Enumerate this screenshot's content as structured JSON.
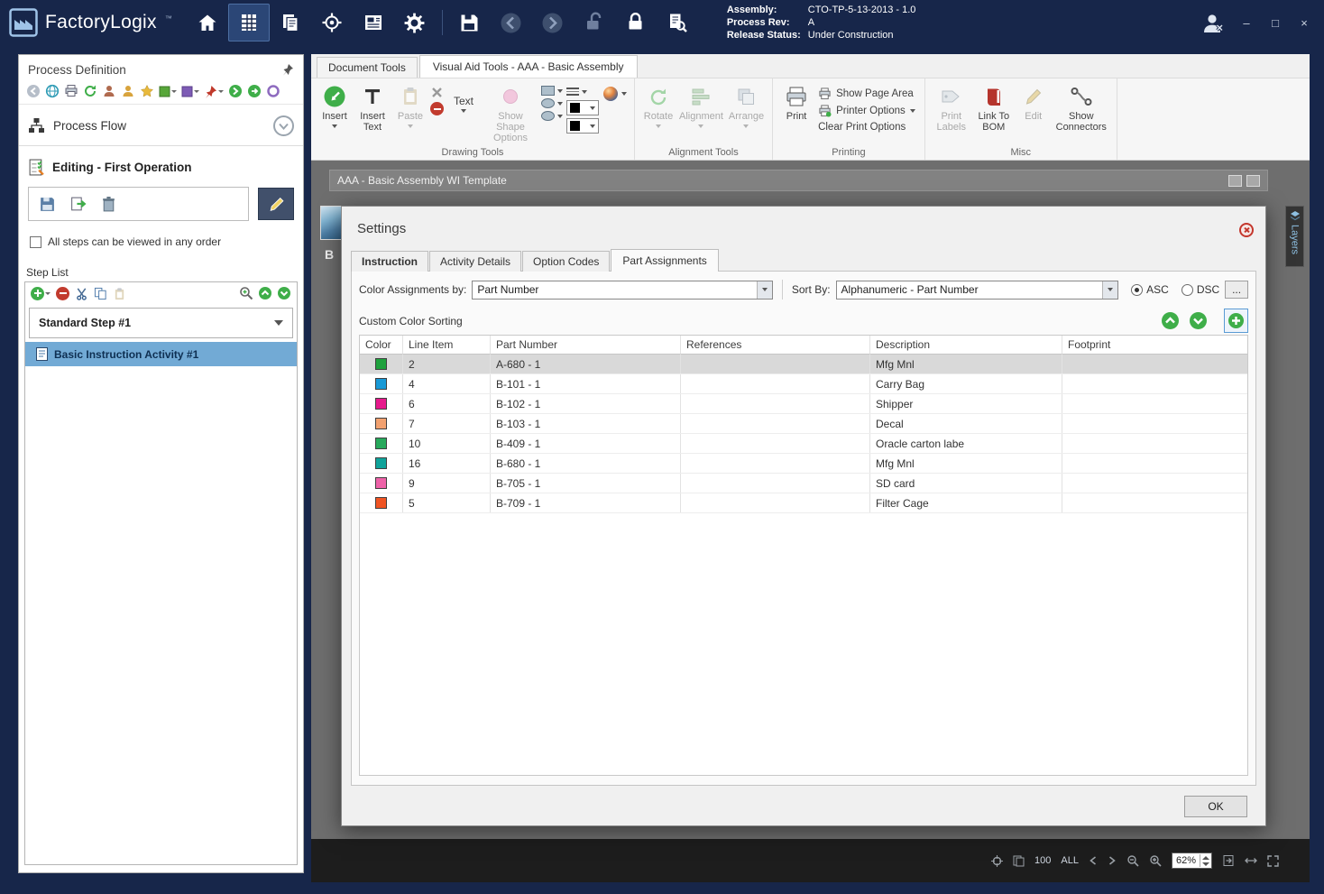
{
  "titlebar": {
    "app_name": "FactoryLogix",
    "tm": "™",
    "assembly_label": "Assembly:",
    "assembly_value": "CTO-TP-5-13-2013 - 1.0",
    "process_rev_label": "Process Rev:",
    "process_rev_value": "A",
    "release_status_label": "Release Status:",
    "release_status_value": "Under Construction",
    "window": {
      "minimize": "–",
      "maximize": "□",
      "close": "×"
    }
  },
  "sidebar": {
    "title": "Process Definition",
    "process_flow": "Process Flow",
    "editing_header": "Editing - First Operation",
    "order_checkbox": "All steps can be viewed in any order",
    "step_list_title": "Step List",
    "step_name": "Standard Step #1",
    "activity_name": "Basic Instruction Activity #1"
  },
  "main": {
    "tabs": {
      "document_tools": "Document Tools",
      "visual_aid": "Visual Aid Tools - AAA - Basic Assembly"
    },
    "ribbon": {
      "insert": "Insert",
      "insert_text": "Insert Text",
      "paste": "Paste",
      "text": "Text",
      "show_shape_options": "Show Shape Options",
      "rotate": "Rotate",
      "alignment": "Alignment",
      "arrange": "Arrange",
      "print": "Print",
      "show_page_area": "Show Page Area",
      "printer_options": "Printer Options",
      "clear_print_options": "Clear Print Options",
      "print_labels": "Print Labels",
      "link_to_bom": "Link To BOM",
      "edit": "Edit",
      "show_connectors": "Show Connectors",
      "groups": {
        "drawing": "Drawing Tools",
        "alignment": "Alignment Tools",
        "printing": "Printing",
        "misc": "Misc"
      }
    },
    "document": {
      "title": "AAA - Basic Assembly WI Template",
      "layers_tab": "Layers",
      "fragment_text": "B"
    },
    "statusbar": {
      "hundred": "100",
      "all": "ALL",
      "zoom": "62%"
    }
  },
  "dialog": {
    "title": "Settings",
    "tabs": [
      "Instruction",
      "Activity Details",
      "Option Codes",
      "Part Assignments"
    ],
    "active_tab": "Part Assignments",
    "color_assignments_label": "Color Assignments by:",
    "color_assignments_value": "Part Number",
    "sort_by_label": "Sort By:",
    "sort_by_value": "Alphanumeric - Part Number",
    "asc_label": "ASC",
    "dsc_label": "DSC",
    "more_label": "...",
    "section_label": "Custom Color Sorting",
    "ok_label": "OK",
    "table": {
      "columns": [
        "Color",
        "Line Item",
        "Part Number",
        "References",
        "Description",
        "Footprint"
      ],
      "rows": [
        {
          "color": "#1ea13d",
          "line": "2",
          "part": "A-680 - 1",
          "ref": "",
          "desc": "Mfg Mnl",
          "fp": ""
        },
        {
          "color": "#1899d6",
          "line": "4",
          "part": "B-101 - 1",
          "ref": "",
          "desc": "Carry Bag",
          "fp": ""
        },
        {
          "color": "#e61a8c",
          "line": "6",
          "part": "B-102 - 1",
          "ref": "",
          "desc": "Shipper",
          "fp": ""
        },
        {
          "color": "#f2a170",
          "line": "7",
          "part": "B-103 - 1",
          "ref": "",
          "desc": "Decal",
          "fp": ""
        },
        {
          "color": "#27a95c",
          "line": "10",
          "part": "B-409 - 1",
          "ref": "",
          "desc": "Oracle carton labe",
          "fp": ""
        },
        {
          "color": "#0fa39a",
          "line": "16",
          "part": "B-680 - 1",
          "ref": "",
          "desc": "Mfg Mnl",
          "fp": ""
        },
        {
          "color": "#ee62a8",
          "line": "9",
          "part": "B-705 - 1",
          "ref": "",
          "desc": "SD card",
          "fp": ""
        },
        {
          "color": "#f05423",
          "line": "5",
          "part": "B-709 - 1",
          "ref": "",
          "desc": "Filter Cage",
          "fp": ""
        }
      ]
    }
  }
}
